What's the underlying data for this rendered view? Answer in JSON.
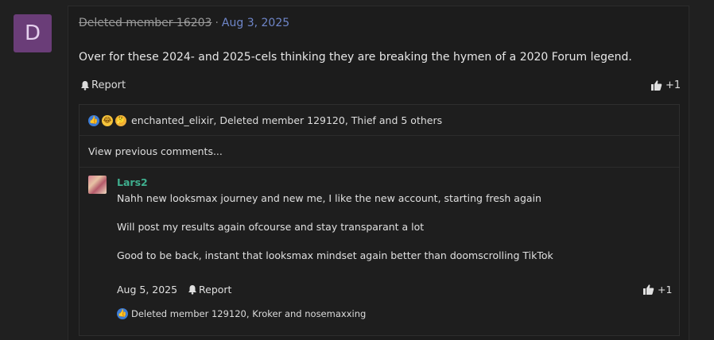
{
  "post": {
    "avatar_letter": "D",
    "author": "Deleted member 16203",
    "separator": "·",
    "date": "Aug 3, 2025",
    "body": "Over for these 2024- and 2025-cels thinking they are breaking the hymen of a 2020 Forum legend.",
    "report_label": "Report",
    "like_count": "+1"
  },
  "reactions": {
    "summary": "enchanted_elixir, Deleted member 129120, Thief and 5 others",
    "icons": [
      "like-icon",
      "laugh-icon",
      "thinking-icon"
    ]
  },
  "comments": {
    "view_previous": "View previous comments...",
    "items": [
      {
        "user": "Lars2",
        "lines": [
          "Nahh new looksmax journey and new me, I like the new account, starting fresh again",
          "Will post my results again ofcourse and stay transparant a lot",
          "Good to be back, instant that looksmax mindset again better than doomscrolling TikTok"
        ],
        "date": "Aug 5, 2025",
        "report_label": "Report",
        "like_count": "+1",
        "reactions_summary": "Deleted member 129120, Kroker and nosemaxxing"
      }
    ]
  },
  "colors": {
    "background": "#202020",
    "post_bg": "#1c1c1c",
    "date_link": "#6f86c9",
    "username": "#3fae8e",
    "avatar_bg": "#6a3d78"
  }
}
